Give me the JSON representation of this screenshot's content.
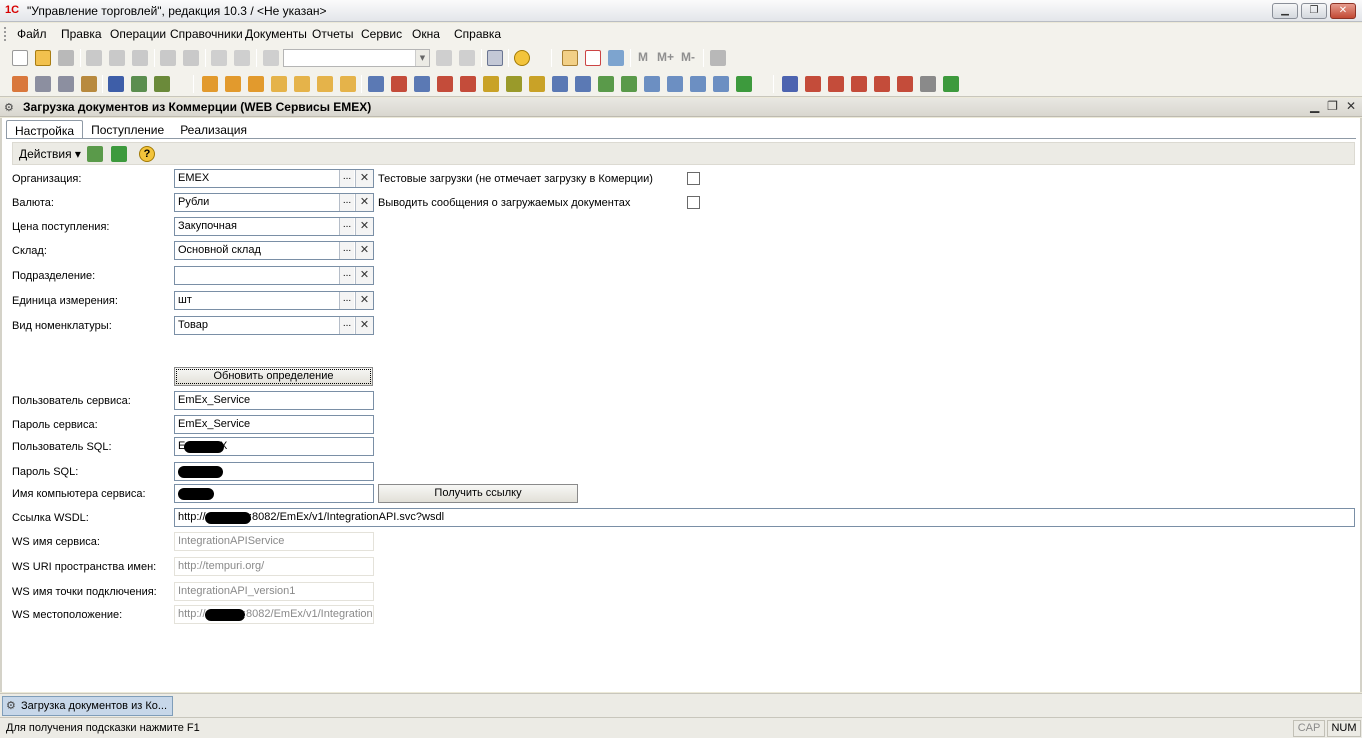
{
  "window": {
    "title": "\"Управление торговлей\", редакция 10.3 / <Не указан>",
    "minimize_glyph": "▁",
    "maximize_glyph": "❐",
    "close_glyph": "✕"
  },
  "menu": [
    "Файл",
    "Правка",
    "Операции",
    "Справочники",
    "Документы",
    "Отчеты",
    "Сервис",
    "Окна",
    "Справка"
  ],
  "toolbar": {
    "combo_value": "",
    "labels": [
      "M",
      "M+",
      "M-"
    ]
  },
  "document": {
    "title": "Загрузка документов из Коммерции (WEB Сервисы EMEX)",
    "controls": [
      "▁",
      "❐",
      "✕"
    ],
    "tabs": [
      "Настройка",
      "Поступление",
      "Реализация"
    ],
    "actions_label": "Действия ▾"
  },
  "form": {
    "organization": {
      "label": "Организация:",
      "value": "EMEX"
    },
    "currency": {
      "label": "Валюта:",
      "value": "Рубли"
    },
    "purchase_price": {
      "label": "Цена поступления:",
      "value": "Закупочная"
    },
    "warehouse": {
      "label": "Склад:",
      "value": "Основной склад"
    },
    "department": {
      "label": "Подразделение:",
      "value": ""
    },
    "unit": {
      "label": "Единица измерения:",
      "value": "шт"
    },
    "item_kind": {
      "label": "Вид номенклатуры:",
      "value": "Товар"
    },
    "select_glyph": "...",
    "clear_glyph": "✕",
    "test_loads": {
      "label": "Тестовые загрузки (не отмечает загрузку в Комерции)",
      "checked": false
    },
    "show_messages": {
      "label": "Выводить сообщения о загружаемых документах",
      "checked": false
    },
    "refresh_button": "Обновить определение",
    "service_user": {
      "label": "Пользователь сервиса:",
      "value": "EmEx_Service"
    },
    "service_password": {
      "label": "Пароль сервиса:",
      "value": "EmEx_Service"
    },
    "sql_user": {
      "label": "Пользователь SQL:",
      "value": "E",
      "suffix": "X"
    },
    "sql_password": {
      "label": "Пароль SQL:",
      "value": ""
    },
    "computer_name": {
      "label": "Имя компьютера сервиса:",
      "value": ""
    },
    "get_link_button": "Получить ссылку",
    "wsdl_link": {
      "label": "Ссылка WSDL:",
      "prefix": "http://",
      "value": ":8082/EmEx/v1/IntegrationAPI.svc?wsdl"
    },
    "ws_service_name": {
      "label": "WS имя сервиса:",
      "value": "IntegrationAPIService"
    },
    "ws_namespace": {
      "label": "WS URI пространства имен:",
      "value": "http://tempuri.org/"
    },
    "ws_endpoint": {
      "label": "WS имя точки подключения:",
      "value": "IntegrationAPI_version1"
    },
    "ws_location": {
      "label": "WS местоположение:",
      "prefix": "http://",
      "value": ":8082/EmEx/v1/Integration"
    }
  },
  "windows_bar": {
    "tab": "Загрузка документов из Ко..."
  },
  "status": {
    "hint": "Для получения подсказки нажмите F1",
    "caps": "CAP",
    "num": "NUM"
  }
}
